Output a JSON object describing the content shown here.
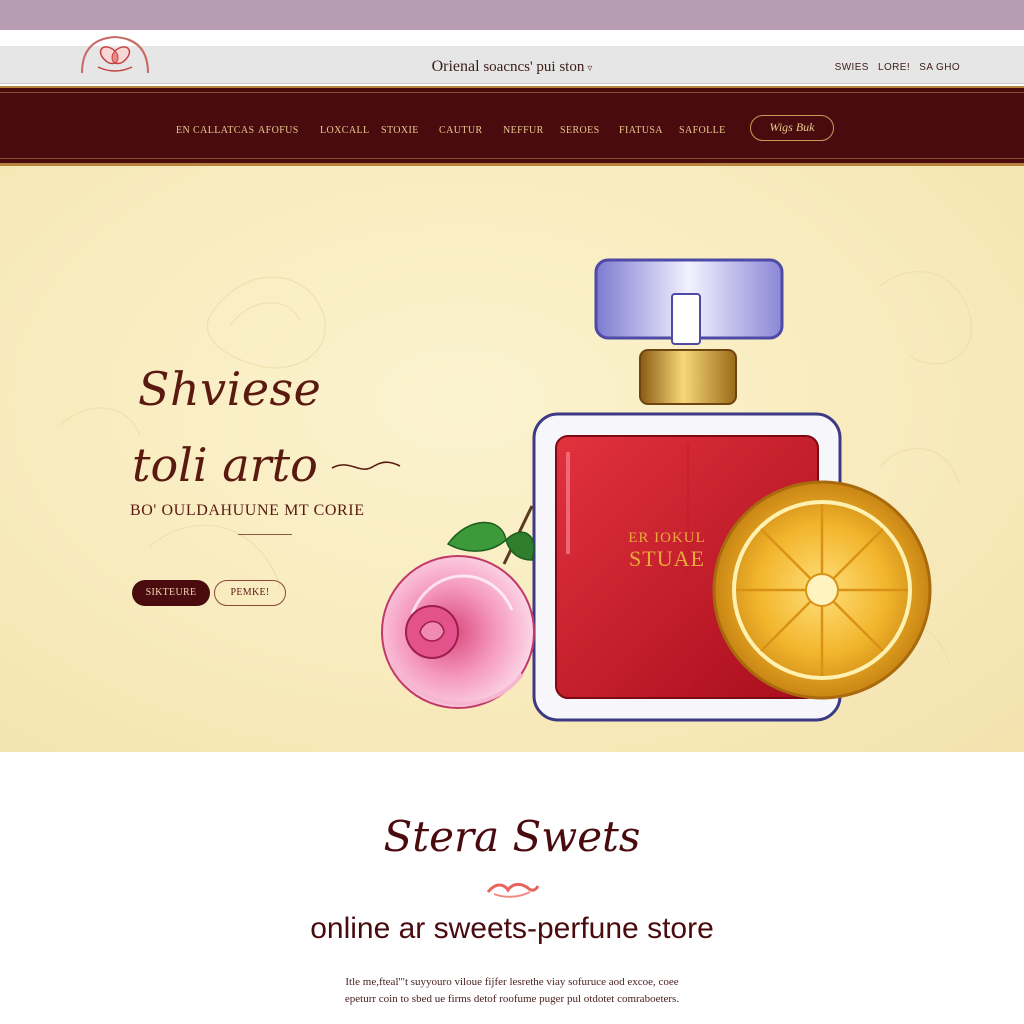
{
  "header": {
    "title_part_a": "Orienal",
    "title_part_b": " soacncs' pui ston",
    "top_links": [
      "SWIES",
      "LORE!",
      "SA GHO"
    ]
  },
  "nav": {
    "items": [
      "EN CALLATCAS",
      "AFOFUS",
      "LOXCALL",
      "STOXIE",
      "CAUTUR",
      "NEFFUR",
      "SEROES",
      "FIATUSA",
      "SAFOLLE"
    ],
    "cta_label": "Wigs Buk"
  },
  "hero": {
    "headline_line1": "Shviese",
    "headline_line2": "toli arto",
    "subtitle": "BO' OULDAHUUNE MT CORIE",
    "primary_button": "SIKTEURE",
    "secondary_button": "PEMKE!",
    "bottle_label_line1": "ER IOKUL",
    "bottle_label_line2": "STUAE"
  },
  "section": {
    "script_title": "Stera Swets",
    "heading": "online ar sweets-perfune store",
    "body_line1": "Itle me,fteal'\"t suyyouro viloue fijfer lesrethe viay sofuruce aod excoe, coee",
    "body_line2": "epeturr coin to sbed ue firms detof roofume puger pul otdotet comraboeters."
  },
  "colors": {
    "top_strip": "#b79cb3",
    "nav_background": "#4a0b0f",
    "gold_accent": "#c99b55",
    "hero_background": "#f8ebbd",
    "heading_text": "#4a0b0f"
  },
  "icons": {
    "logo": "rose-logo-icon",
    "title_dropdown": "chevron-down-icon"
  }
}
